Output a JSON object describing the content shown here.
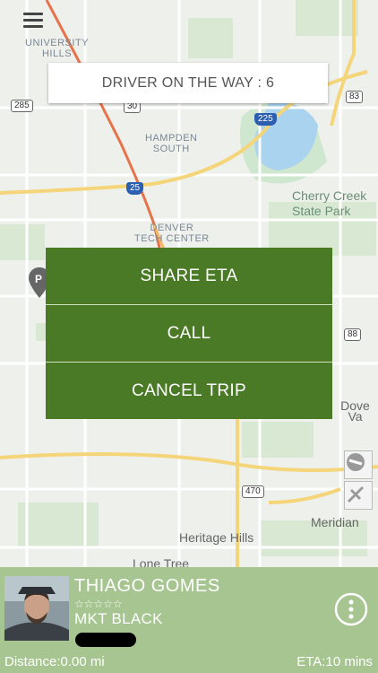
{
  "map": {
    "labels": {
      "university_hills": "UNIVERSITY\nHILLS",
      "hampden_south": "HAMPDEN\nSOUTH",
      "denver_tech_center": "DENVER\nTECH CENTER",
      "cherry_creek": "Cherry Creek\nState Park",
      "dove_valley": "Dove Va",
      "meridian": "Meridian",
      "heritage_hills": "Heritage Hills",
      "lone_tree": "Lone Tree"
    },
    "shields": {
      "r285": "285",
      "r30": "30",
      "r83": "83",
      "i225": "225",
      "i25": "25",
      "r88": "88",
      "r470": "470"
    },
    "pin_letter": "P"
  },
  "status": {
    "text": "DRIVER ON THE WAY : 6"
  },
  "actions": {
    "share_eta": "SHARE ETA",
    "call": "CALL",
    "cancel_trip": "CANCEL TRIP"
  },
  "driver": {
    "name": "THIAGO GOMES",
    "rating_stars": "☆☆☆☆☆",
    "car_model": "MKT BLACK"
  },
  "trip": {
    "distance": "Distance:0.00 mi",
    "eta": "ETA:10 mins"
  },
  "colors": {
    "action_green": "#4a7a26",
    "panel_green": "#a6c590"
  }
}
